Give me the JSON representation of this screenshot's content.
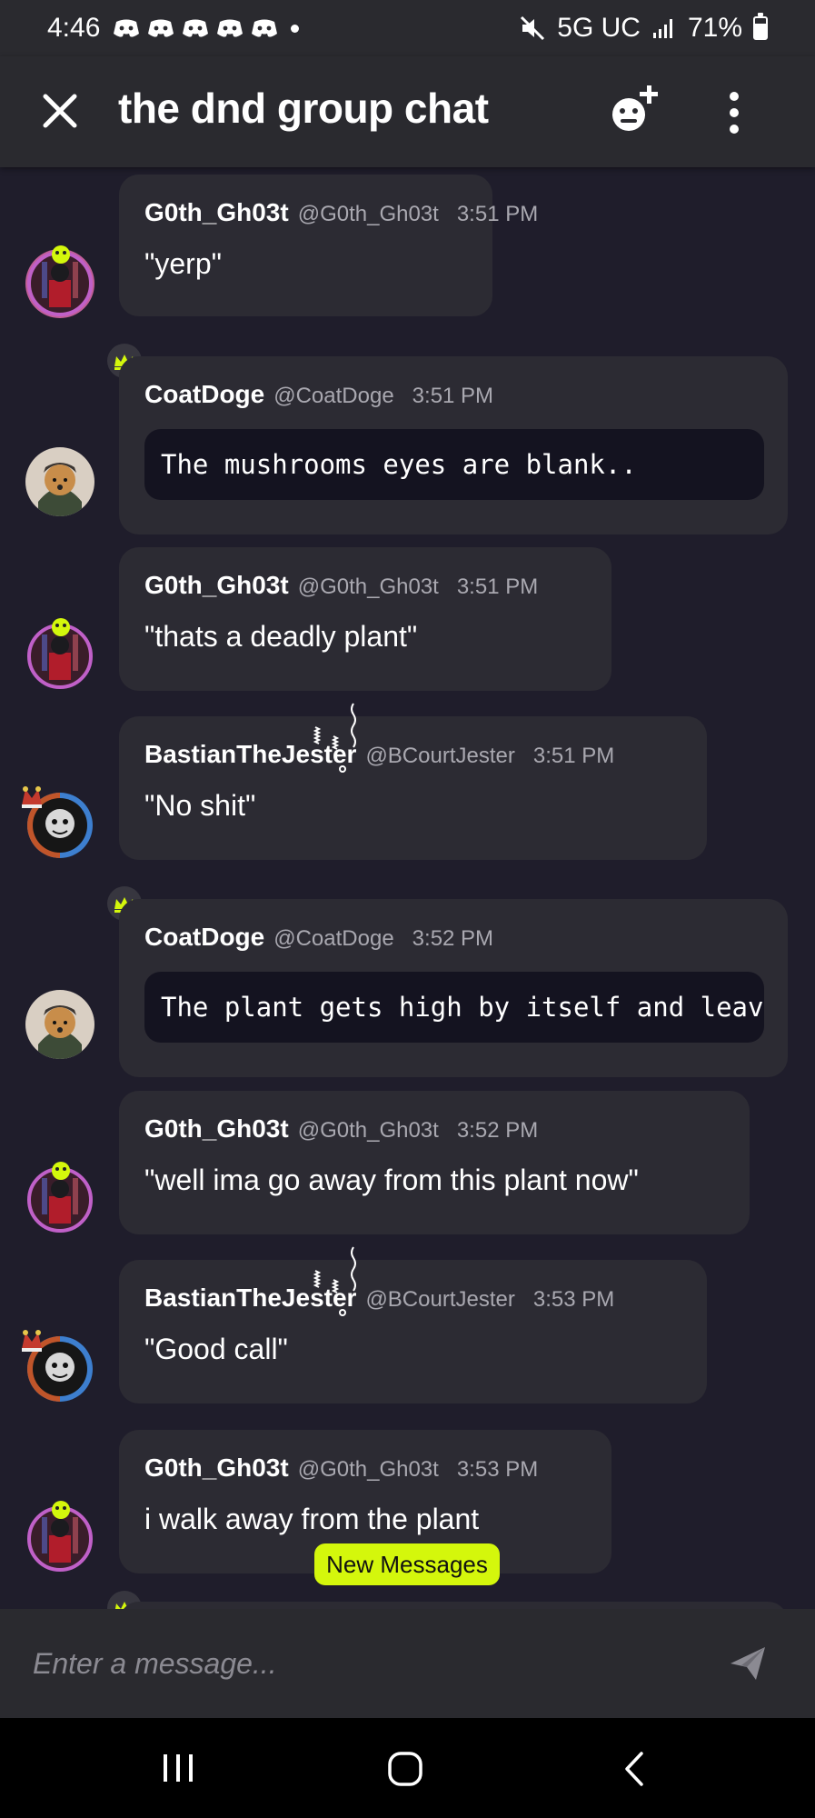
{
  "status_bar": {
    "time": "4:46",
    "network": "5G UC",
    "battery": "71%"
  },
  "header": {
    "title": "the dnd group chat"
  },
  "messages": [
    {
      "author": "G0th_Gh03t",
      "handle": "@G0th_Gh03t",
      "time": "3:51 PM",
      "text": "\"yerp\"",
      "style": "text"
    },
    {
      "author": "CoatDoge",
      "handle": "@CoatDoge",
      "time": "3:51 PM",
      "text": "The mushrooms eyes are blank..",
      "style": "code"
    },
    {
      "author": "G0th_Gh03t",
      "handle": "@G0th_Gh03t",
      "time": "3:51 PM",
      "text": "\"thats a deadly plant\"",
      "style": "text"
    },
    {
      "author": "BastianTheJester",
      "handle": "@BCourtJester",
      "time": "3:51 PM",
      "text": "\"No shit\"",
      "style": "text"
    },
    {
      "author": "CoatDoge",
      "handle": "@CoatDoge",
      "time": "3:52 PM",
      "text": "The plant gets high by itself and leaves",
      "style": "code"
    },
    {
      "author": "G0th_Gh03t",
      "handle": "@G0th_Gh03t",
      "time": "3:52 PM",
      "text": "\"well ima go away from this plant now\"",
      "style": "text"
    },
    {
      "author": "BastianTheJester",
      "handle": "@BCourtJester",
      "time": "3:53 PM",
      "text": "\"Good call\"",
      "style": "text"
    },
    {
      "author": "G0th_Gh03t",
      "handle": "@G0th_Gh03t",
      "time": "3:53 PM",
      "text": "i walk away from the plant",
      "style": "text"
    }
  ],
  "new_messages_label": "New Messages",
  "composer": {
    "placeholder": "Enter a message..."
  },
  "colors": {
    "accent": "#d4f70c",
    "crown": "#d4f70c",
    "bubble": "#2c2b33",
    "background": "#1f1d2b"
  }
}
